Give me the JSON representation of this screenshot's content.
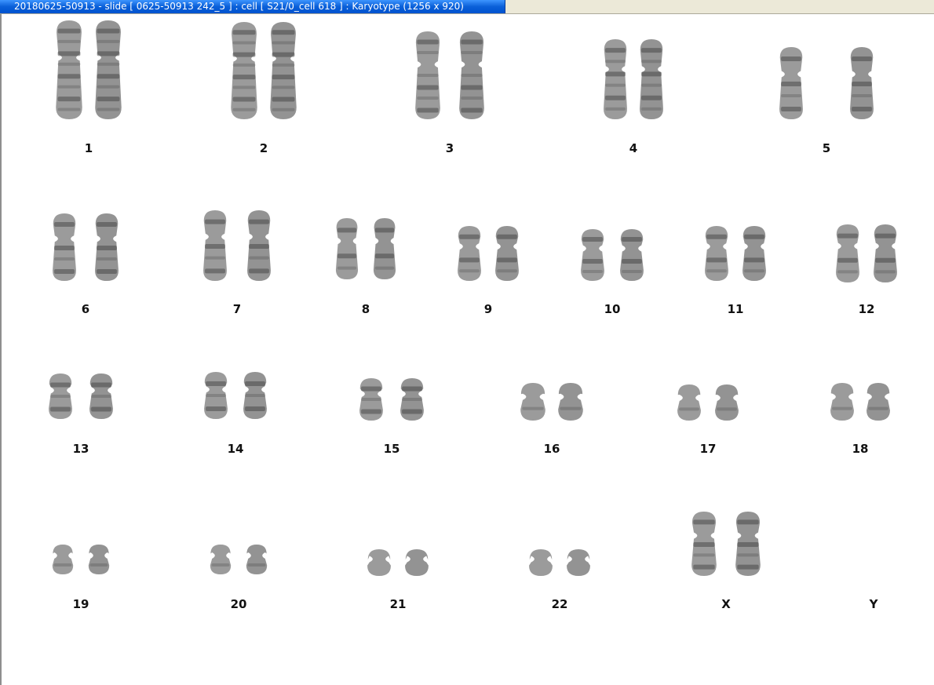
{
  "window": {
    "title": "20180625-50913 - slide [ 0625-50913 242_5 ] : cell [ S21/0_cell 618 ] : Karyotype  (1256 x 920)"
  },
  "karyotype": {
    "chromosomes": [
      {
        "label": "1"
      },
      {
        "label": "2"
      },
      {
        "label": "3"
      },
      {
        "label": "4"
      },
      {
        "label": "5"
      },
      {
        "label": "6"
      },
      {
        "label": "7"
      },
      {
        "label": "8"
      },
      {
        "label": "9"
      },
      {
        "label": "10"
      },
      {
        "label": "11"
      },
      {
        "label": "12"
      },
      {
        "label": "13"
      },
      {
        "label": "14"
      },
      {
        "label": "15"
      },
      {
        "label": "16"
      },
      {
        "label": "17"
      },
      {
        "label": "18"
      },
      {
        "label": "19"
      },
      {
        "label": "20"
      },
      {
        "label": "21"
      },
      {
        "label": "22"
      },
      {
        "label": "X"
      },
      {
        "label": "Y"
      }
    ]
  }
}
